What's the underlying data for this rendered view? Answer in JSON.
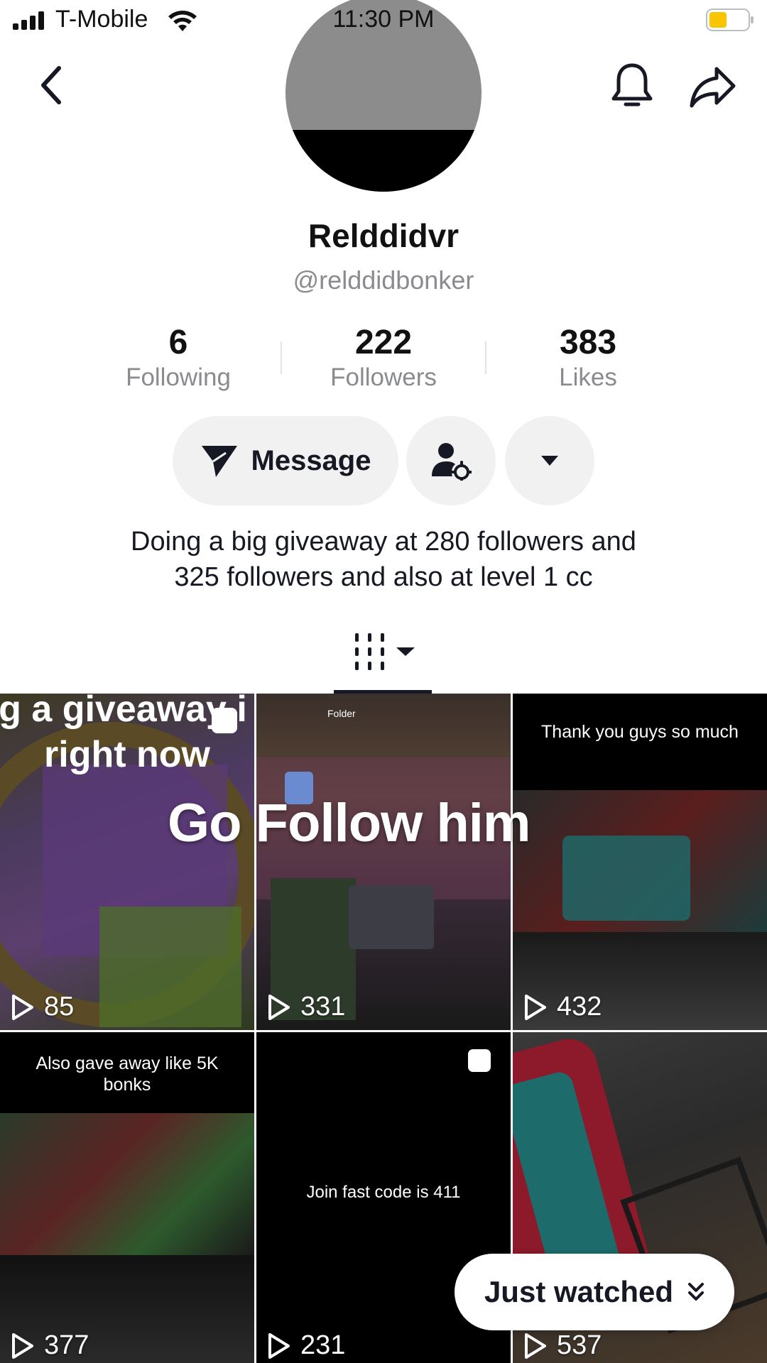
{
  "status_bar": {
    "carrier": "T-Mobile",
    "time": "11:30 PM",
    "battery_color": "#f7c600"
  },
  "profile": {
    "display_name": "Relddidvr",
    "username": "@relddidbonker",
    "stats": [
      {
        "value": "6",
        "label": "Following"
      },
      {
        "value": "222",
        "label": "Followers"
      },
      {
        "value": "383",
        "label": "Likes"
      }
    ],
    "message_label": "Message",
    "bio_line1": "Doing a big giveaway at 280 followers and",
    "bio_line2": "325 followers and also at level 1 cc"
  },
  "overlay_text": "Go Follow him",
  "videos": [
    {
      "views": "85",
      "caption_line1": "g a giveaway i",
      "caption_line2": "right now"
    },
    {
      "views": "331",
      "caption": "Folder"
    },
    {
      "views": "432",
      "caption": "Thank you guys so much"
    },
    {
      "views": "377",
      "caption_line1": "Also gave away like 5K",
      "caption_line2": "bonks"
    },
    {
      "views": "231",
      "caption": "Join fast code is 411"
    },
    {
      "views": "537"
    }
  ],
  "just_watched_label": "Just watched",
  "colors": {
    "text_primary": "#161823",
    "text_secondary": "#8a8b91",
    "pill_bg": "#f1f1f2"
  }
}
